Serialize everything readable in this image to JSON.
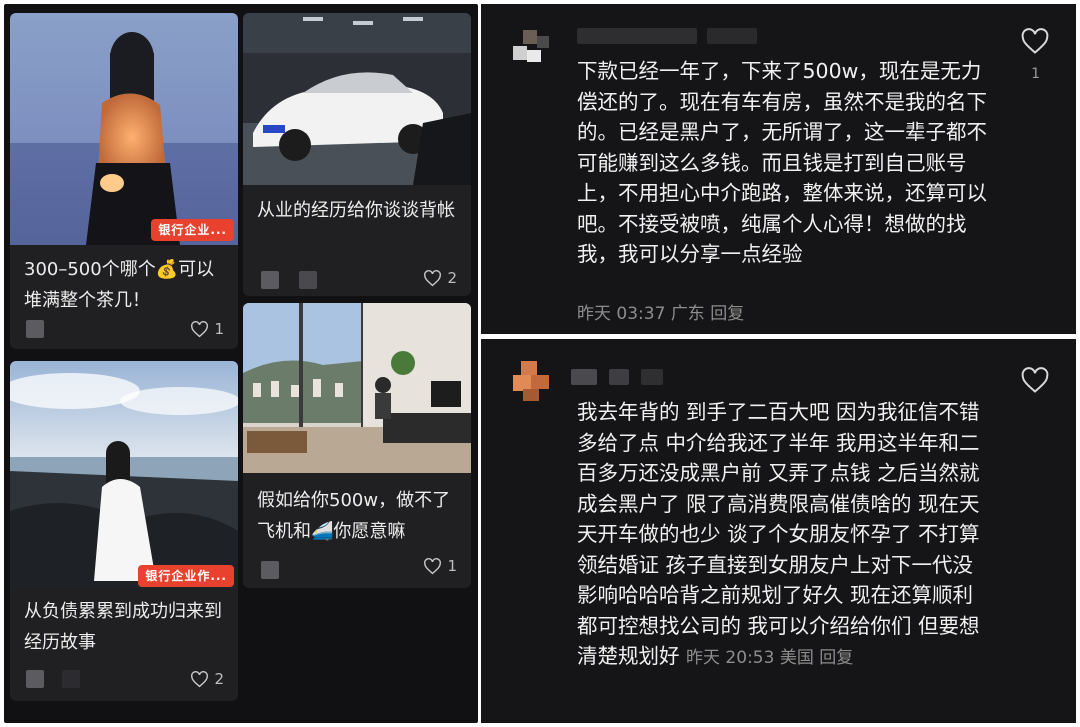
{
  "feed": {
    "cards": [
      {
        "title": "300–500个哪个💰可以堆满整个茶几！",
        "likes": "1",
        "tag": "银行企业..."
      },
      {
        "title": "从业的经历给你谈谈背帐",
        "likes": "2"
      },
      {
        "title": "从负债累累到成功归来到经历故事",
        "likes": "2",
        "tag": "银行企业作..."
      },
      {
        "title": "假如给你500w，做不了飞机和🚄你愿意嘛",
        "likes": "1"
      }
    ]
  },
  "comments": [
    {
      "body": "下款已经一年了，下来了500w，现在是无力偿还的了。现在有车有房，虽然不是我的名下的。已经是黑户了，无所谓了，这一辈子都不可能赚到这么多钱。而且钱是打到自己账号上，不用担心中介跑路，整体来说，还算可以吧。不接受被喷，纯属个人心得！想做的找我，我可以分享一点经验",
      "time": "昨天 03:37",
      "location": "广东",
      "reply": "回复",
      "likes": "1"
    },
    {
      "body": "我去年背的 到手了二百大吧 因为我征信不错 多给了点 中介给我还了半年 我用这半年和二百多万还没成黑户前 又弄了点钱 之后当然就成会黑户了 限了高消费限高催债啥的 现在天天开车做的也少 谈了个女朋友怀孕了 不打算领结婚证 孩子直接到女朋友户上对下一代没影响哈哈哈背之前规划了好久 现在还算顺利 都可控想找公司的 我可以介绍给你们 但要想清楚规划好",
      "time": "昨天 20:53",
      "location": "美国",
      "reply": "回复"
    }
  ]
}
